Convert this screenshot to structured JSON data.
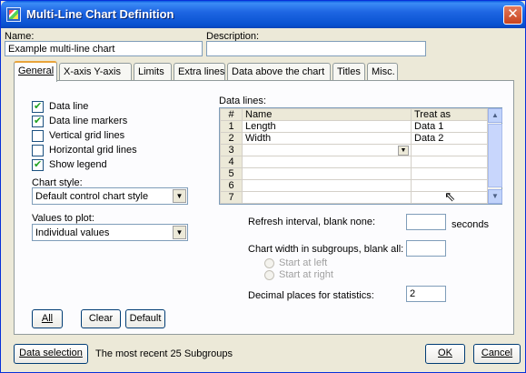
{
  "window": {
    "title": "Multi-Line Chart Definition",
    "close_glyph": "✕"
  },
  "fields": {
    "name_label": "Name:",
    "name_value": "Example multi-line chart",
    "description_label": "Description:",
    "description_value": ""
  },
  "tabs": [
    {
      "label": "General",
      "active": true
    },
    {
      "label": "X-axis Y-axis",
      "active": false
    },
    {
      "label": "Limits",
      "active": false
    },
    {
      "label": "Extra lines",
      "active": false
    },
    {
      "label": "Data above the chart",
      "active": false
    },
    {
      "label": "Titles",
      "active": false
    },
    {
      "label": "Misc.",
      "active": false
    }
  ],
  "general": {
    "checkboxes": [
      {
        "label": "Data line",
        "checked": true
      },
      {
        "label": "Data line markers",
        "checked": true
      },
      {
        "label": "Vertical grid lines",
        "checked": false
      },
      {
        "label": "Horizontal grid lines",
        "checked": false
      },
      {
        "label": "Show legend",
        "checked": true
      }
    ],
    "chart_style_label": "Chart style:",
    "chart_style_value": "Default control chart style",
    "values_to_plot_label": "Values to plot:",
    "values_to_plot_value": "Individual values",
    "buttons": {
      "all": "All",
      "clear": "Clear",
      "default": "Default"
    }
  },
  "data_lines": {
    "label": "Data lines:",
    "columns": [
      "#",
      "Name",
      "Treat as"
    ],
    "rows": [
      {
        "num": "1",
        "name": "Length",
        "treat_as": "Data 1"
      },
      {
        "num": "2",
        "name": "Width",
        "treat_as": "Data 2"
      },
      {
        "num": "3",
        "name": "",
        "treat_as": ""
      },
      {
        "num": "4",
        "name": "",
        "treat_as": ""
      },
      {
        "num": "5",
        "name": "",
        "treat_as": ""
      },
      {
        "num": "6",
        "name": "",
        "treat_as": ""
      },
      {
        "num": "7",
        "name": "",
        "treat_as": ""
      }
    ]
  },
  "settings": {
    "refresh_label": "Refresh interval, blank  none:",
    "refresh_value": "",
    "refresh_unit": "seconds",
    "width_label": "Chart width in subgroups, blank  all:",
    "width_value": "",
    "start_left": "Start at left",
    "start_right": "Start at right",
    "decimal_label": "Decimal places for statistics:",
    "decimal_value": "2"
  },
  "footer": {
    "data_selection": "Data selection",
    "status": "The most recent 25 Subgroups",
    "ok": "OK",
    "cancel": "Cancel"
  },
  "icons": {
    "window_icon": "chart-window-icon",
    "close": "close-icon",
    "combo_arrow": "chevron-down-icon",
    "scroll_up": "scroll-up-icon",
    "scroll_down": "scroll-down-icon",
    "cursor": "mouse-pointer-icon"
  }
}
